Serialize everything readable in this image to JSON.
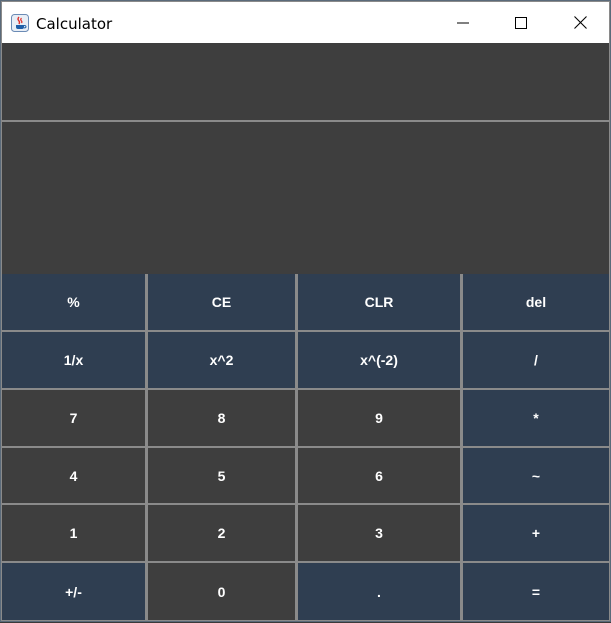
{
  "window": {
    "title": "Calculator",
    "app_icon": "java-icon",
    "controls": {
      "minimize_icon": "minimize-icon",
      "maximize_icon": "maximize-icon",
      "close_icon": "close-icon"
    }
  },
  "display": {
    "expression": "",
    "result": ""
  },
  "colors": {
    "function_key": "#2f3e51",
    "number_key": "#3e3e3e",
    "display_bg": "#3e3e3e",
    "grid_line": "#8a8a8a",
    "key_text": "#ffffff"
  },
  "keys": [
    {
      "label": "%",
      "type": "fn"
    },
    {
      "label": "CE",
      "type": "fn"
    },
    {
      "label": "CLR",
      "type": "fn"
    },
    {
      "label": "del",
      "type": "fn"
    },
    {
      "label": "1/x",
      "type": "fn"
    },
    {
      "label": "x^2",
      "type": "fn"
    },
    {
      "label": "x^(-2)",
      "type": "fn"
    },
    {
      "label": "/",
      "type": "fn"
    },
    {
      "label": "7",
      "type": "num"
    },
    {
      "label": "8",
      "type": "num"
    },
    {
      "label": "9",
      "type": "num"
    },
    {
      "label": "*",
      "type": "fn"
    },
    {
      "label": "4",
      "type": "num"
    },
    {
      "label": "5",
      "type": "num"
    },
    {
      "label": "6",
      "type": "num"
    },
    {
      "label": "~",
      "type": "fn"
    },
    {
      "label": "1",
      "type": "num"
    },
    {
      "label": "2",
      "type": "num"
    },
    {
      "label": "3",
      "type": "num"
    },
    {
      "label": "+",
      "type": "fn"
    },
    {
      "label": "+/-",
      "type": "fn"
    },
    {
      "label": "0",
      "type": "num"
    },
    {
      "label": ".",
      "type": "fn"
    },
    {
      "label": "=",
      "type": "fn"
    }
  ]
}
